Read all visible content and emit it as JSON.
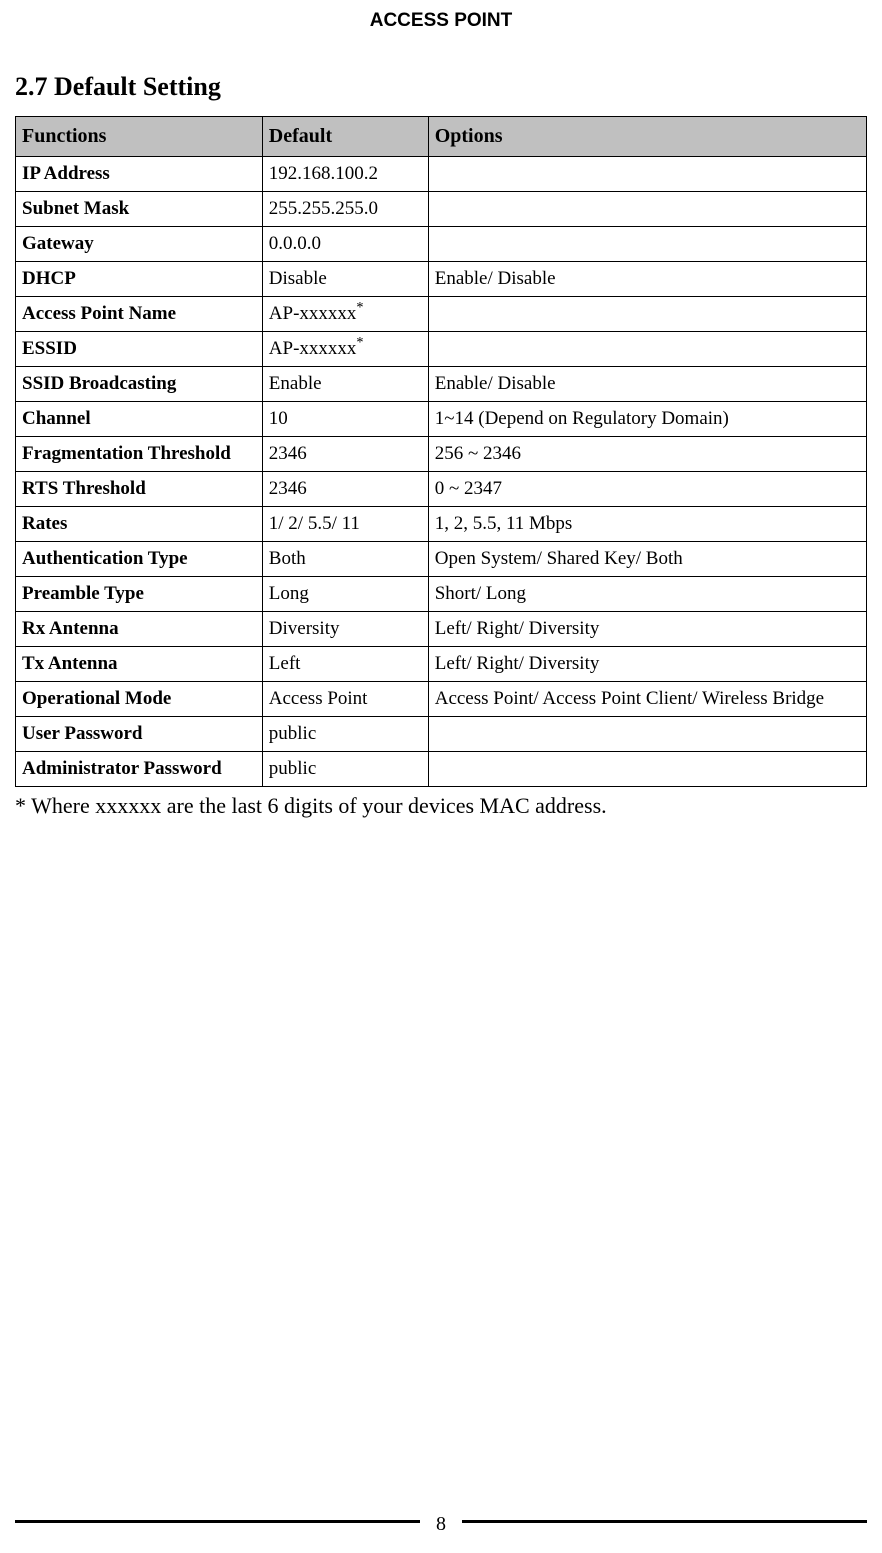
{
  "page": {
    "header": "ACCESS POINT",
    "number": "8"
  },
  "section": {
    "title": "2.7 Default Setting"
  },
  "table": {
    "headers": {
      "functions": "Functions",
      "default": "Default",
      "options": "Options"
    },
    "rows": [
      {
        "func": "IP Address",
        "def": "192.168.100.2",
        "opt": ""
      },
      {
        "func": "Subnet Mask",
        "def": "255.255.255.0",
        "opt": ""
      },
      {
        "func": "Gateway",
        "def": "0.0.0.0",
        "opt": ""
      },
      {
        "func": "DHCP",
        "def": "Disable",
        "opt": "Enable/ Disable"
      },
      {
        "func": "Access Point Name",
        "def": "AP-xxxxxx",
        "opt": "",
        "sup": "*"
      },
      {
        "func": "ESSID",
        "def": "AP-xxxxxx",
        "opt": "",
        "sup": "*"
      },
      {
        "func": "SSID Broadcasting",
        "def": "Enable",
        "opt": "Enable/ Disable"
      },
      {
        "func": "Channel",
        "def": "10",
        "opt": "1~14 (Depend on Regulatory Domain)"
      },
      {
        "func": "Fragmentation Threshold",
        "def": "2346",
        "opt": "256 ~ 2346"
      },
      {
        "func": "RTS Threshold",
        "def": "2346",
        "opt": "0 ~ 2347"
      },
      {
        "func": "Rates",
        "def": "1/ 2/ 5.5/ 11",
        "opt": "1, 2, 5.5, 11 Mbps"
      },
      {
        "func": "Authentication Type",
        "def": "Both",
        "opt": "Open System/ Shared Key/ Both"
      },
      {
        "func": "Preamble Type",
        "def": "Long",
        "opt": "Short/ Long"
      },
      {
        "func": "Rx Antenna",
        "def": "Diversity",
        "opt": "Left/ Right/ Diversity"
      },
      {
        "func": "Tx Antenna",
        "def": "Left",
        "opt": "Left/ Right/ Diversity"
      },
      {
        "func": "Operational Mode",
        "def": "Access Point",
        "opt": "Access Point/ Access Point Client/ Wireless Bridge"
      },
      {
        "func": "User Password",
        "def": "public",
        "opt": ""
      },
      {
        "func": "Administrator Password",
        "def": "public",
        "opt": ""
      }
    ]
  },
  "footnote": "* Where xxxxxx are the last 6 digits of your devices MAC address."
}
